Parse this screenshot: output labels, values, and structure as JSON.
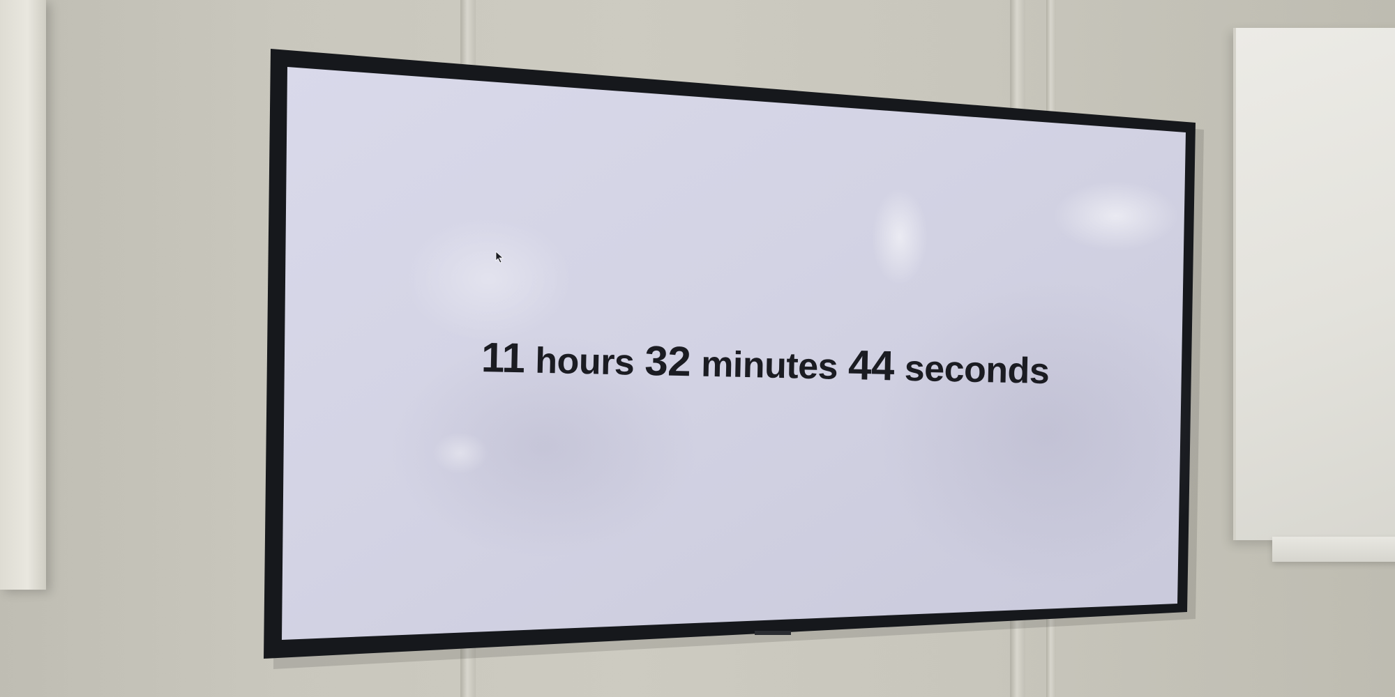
{
  "screen": {
    "countdown": {
      "hours_value": "11",
      "hours_label": "hours",
      "minutes_value": "32",
      "minutes_label": "minutes",
      "seconds_value": "44",
      "seconds_label": "seconds"
    }
  },
  "colors": {
    "wall": "#c9c7bd",
    "bezel": "#16181c",
    "screen": "#d7d7e6",
    "text": "#1b1c22"
  }
}
